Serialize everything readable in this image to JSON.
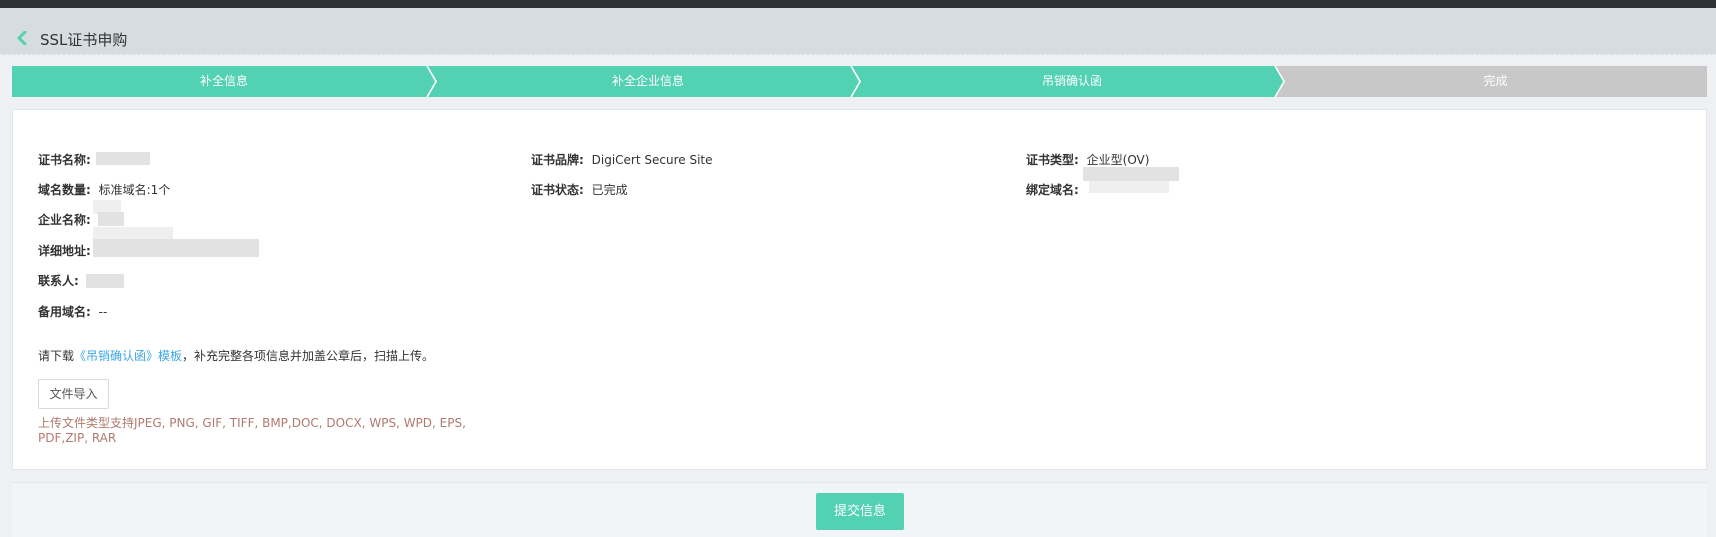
{
  "header": {
    "title": "SSL证书申购",
    "back_icon": "chevron-left-icon"
  },
  "steps": [
    {
      "label": "补全信息",
      "state": "done"
    },
    {
      "label": "补全企业信息",
      "state": "done"
    },
    {
      "label": "吊销确认函",
      "state": "active"
    },
    {
      "label": "完成",
      "state": "pending"
    }
  ],
  "colors": {
    "accent": "#52d1b3",
    "step_pending": "#c8c8c8",
    "link": "#3da7e8",
    "tip": "#b07a6e"
  },
  "cert": {
    "name_label": "证书名称:",
    "brand_label": "证书品牌:",
    "brand_value": "DigiCert Secure Site",
    "type_label": "证书类型:",
    "type_value": "企业型(OV)",
    "domain_count_label": "域名数量:",
    "domain_count_value": "标准域名:1个",
    "status_label": "证书状态:",
    "status_value": "已完成",
    "bind_domain_label": "绑定域名:",
    "company_label": "企业名称:",
    "address_label": "详细地址:",
    "contact_label": "联系人:",
    "backup_domain_label": "备用域名:",
    "backup_domain_value": "--"
  },
  "upload": {
    "hint_prefix": "请下载",
    "hint_link": "《吊销确认函》模板",
    "hint_suffix": "，补充完整各项信息并加盖公章后，扫描上传。",
    "button_label": "文件导入",
    "tip": "上传文件类型支持JPEG, PNG, GIF, TIFF, BMP,DOC, DOCX, WPS, WPD, EPS, PDF,ZIP, RAR"
  },
  "footer": {
    "submit_label": "提交信息"
  }
}
